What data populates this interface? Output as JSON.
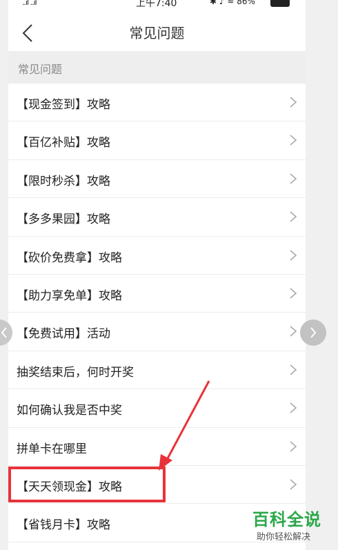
{
  "status_bar": {
    "left": "..ıl ..ıl",
    "time": "上午7:40",
    "icons": "✱ ♪ ≈ 86%",
    "battery_icon": "battery-icon"
  },
  "nav": {
    "title": "常见问题",
    "back_icon": "chevron-left-icon"
  },
  "section": {
    "title": "常见问题"
  },
  "faq_items": [
    {
      "label": "【现金签到】攻略"
    },
    {
      "label": "【百亿补贴】攻略"
    },
    {
      "label": "【限时秒杀】攻略"
    },
    {
      "label": "【多多果园】攻略"
    },
    {
      "label": "【砍价免费拿】攻略"
    },
    {
      "label": "【助力享免单】攻略"
    },
    {
      "label": "【免费试用】活动"
    },
    {
      "label": "抽奖结束后，何时开奖"
    },
    {
      "label": "如何确认我是否中奖"
    },
    {
      "label": "拼单卡在哪里"
    },
    {
      "label": "【天天领现金】攻略"
    },
    {
      "label": "【省钱月卡】攻略"
    }
  ],
  "watermark": {
    "main": "百科全说",
    "sub": "助你轻松解决"
  },
  "colors": {
    "highlight": "#e8323a",
    "watermark": "#2aa84a"
  }
}
